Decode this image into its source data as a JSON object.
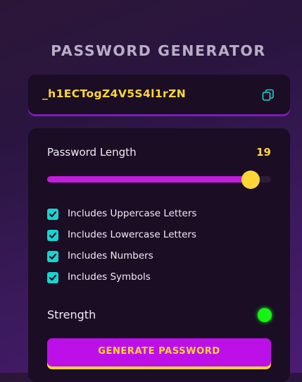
{
  "app": {
    "title": "PASSWORD GENERATOR"
  },
  "password": {
    "value": "_h1ECTogZ4V5S4l1rZN",
    "copy_icon": "copy-icon"
  },
  "length": {
    "label": "Password Length",
    "value": "19",
    "slider_fraction": 0.91
  },
  "options": [
    {
      "label": "Includes Uppercase Letters",
      "checked": true
    },
    {
      "label": "Includes Lowercase Letters",
      "checked": true
    },
    {
      "label": "Includes Numbers",
      "checked": true
    },
    {
      "label": "Includes Symbols",
      "checked": true
    }
  ],
  "strength": {
    "label": "Strength",
    "color": "#14f514"
  },
  "generate": {
    "label": "GENERATE PASSWORD"
  },
  "colors": {
    "accent": "#c41de0",
    "highlight": "#ffd635",
    "checkbox": "#17d4d0"
  }
}
